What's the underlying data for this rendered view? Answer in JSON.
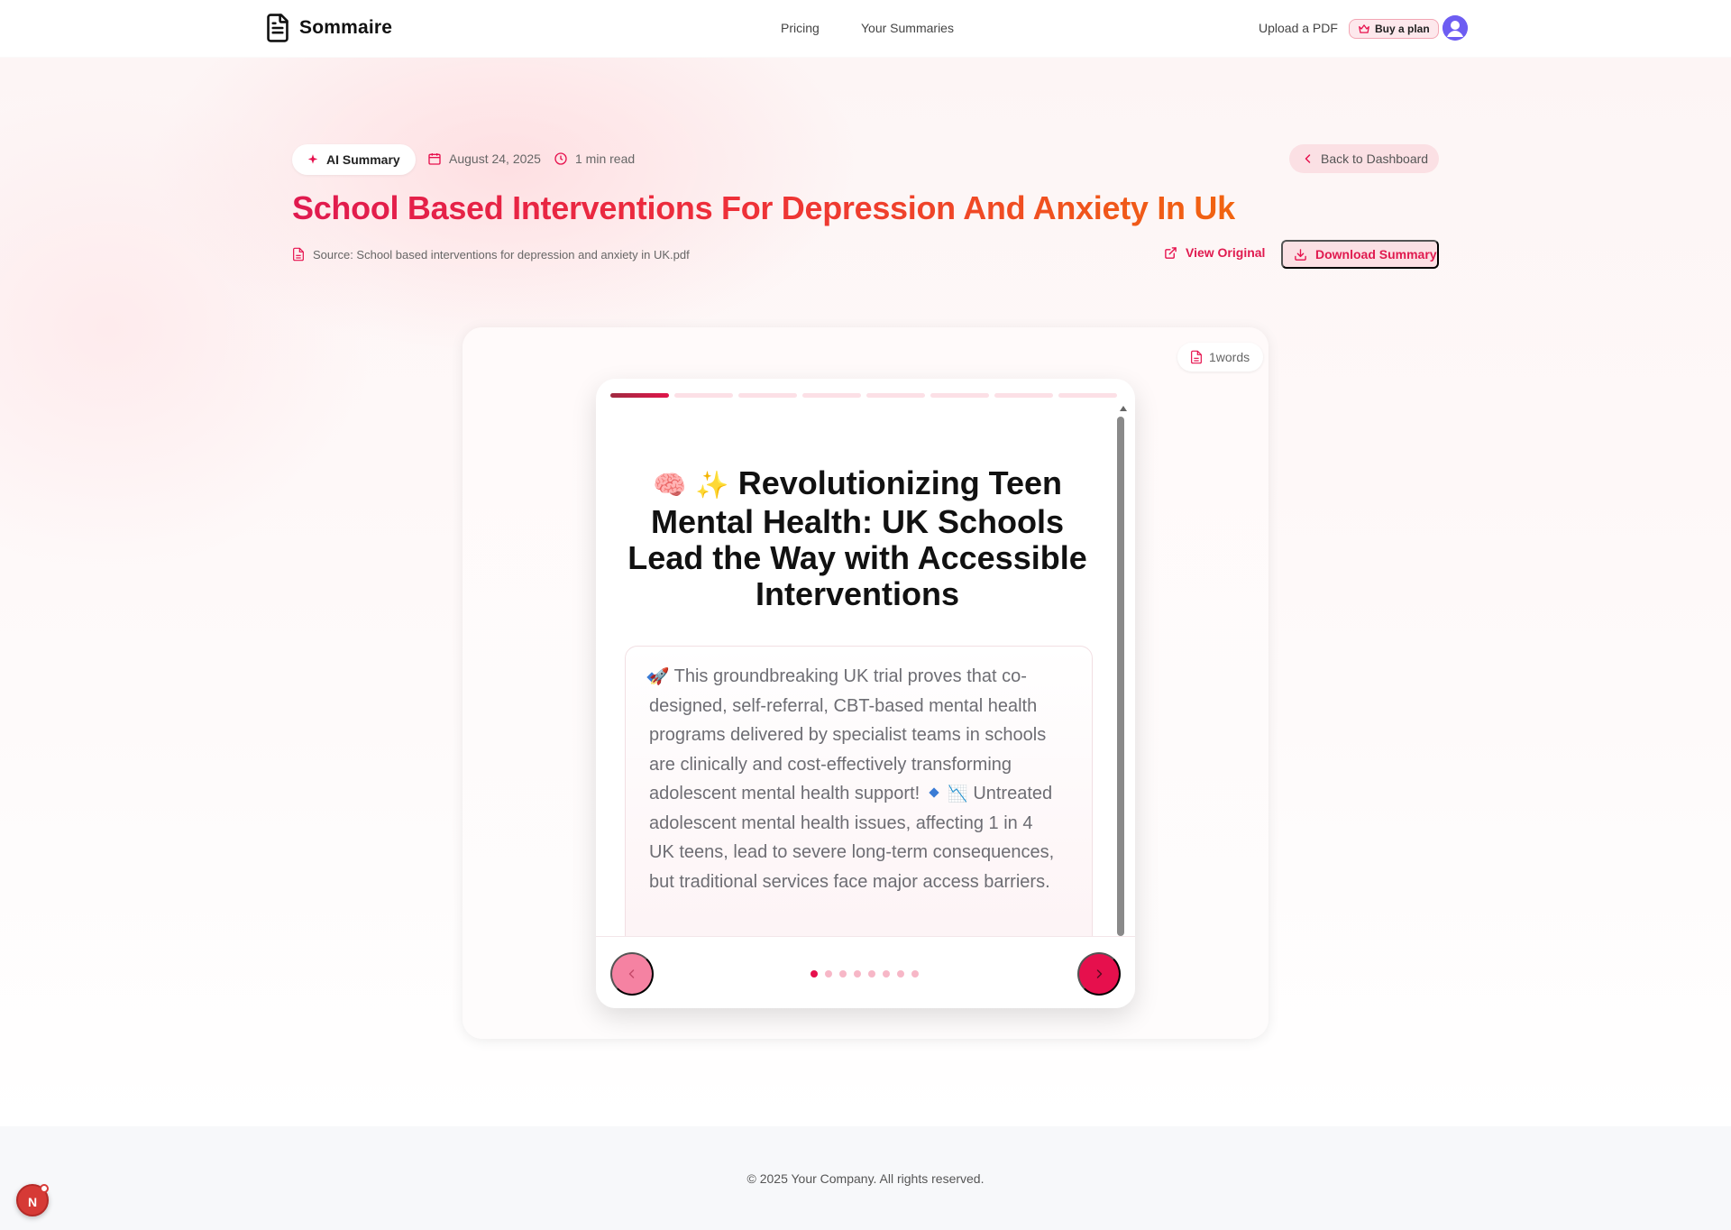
{
  "app": {
    "name": "Sommaire"
  },
  "nav": {
    "pricing": "Pricing",
    "your_summaries": "Your Summaries",
    "upload_pdf": "Upload a PDF",
    "buy_plan": "Buy a plan"
  },
  "meta": {
    "badge": "AI Summary",
    "date": "August 24, 2025",
    "read_time": "1 min read",
    "back_label": "Back to Dashboard"
  },
  "summary": {
    "title": "School Based Interventions For Depression And Anxiety In Uk",
    "source": "Source: School based interventions for depression and anxiety in UK.pdf",
    "view_original": "View Original",
    "download": "Download Summary",
    "word_count": "1words"
  },
  "slide": {
    "emoji_brain": "🧠",
    "emoji_sparkles": "✨",
    "heading": "Revolutionizing Teen Mental Health: UK Schools Lead the Way with Accessible Interventions",
    "point1_emoji": "🚀",
    "point1": "This groundbreaking UK trial proves that co-designed, self-referral, CBT-based mental health programs delivered by specialist teams in schools are clinically and cost-effectively transforming adolescent mental health support!",
    "point2_emoji": "📉",
    "point2": "Untreated adolescent mental health issues, affecting 1 in 4 UK teens, lead to severe long-term consequences, but traditional services face major access barriers.",
    "total_sections": 8,
    "current_section": 1
  },
  "footer": {
    "copyright": "© 2025 Your Company. All rights reserved.",
    "dev_badge": "N"
  },
  "colors": {
    "accent": "#e6104d",
    "accent_soft": "#fbe0e4",
    "title_gradient_start": "#e01a4f",
    "title_gradient_end": "#f16410"
  }
}
